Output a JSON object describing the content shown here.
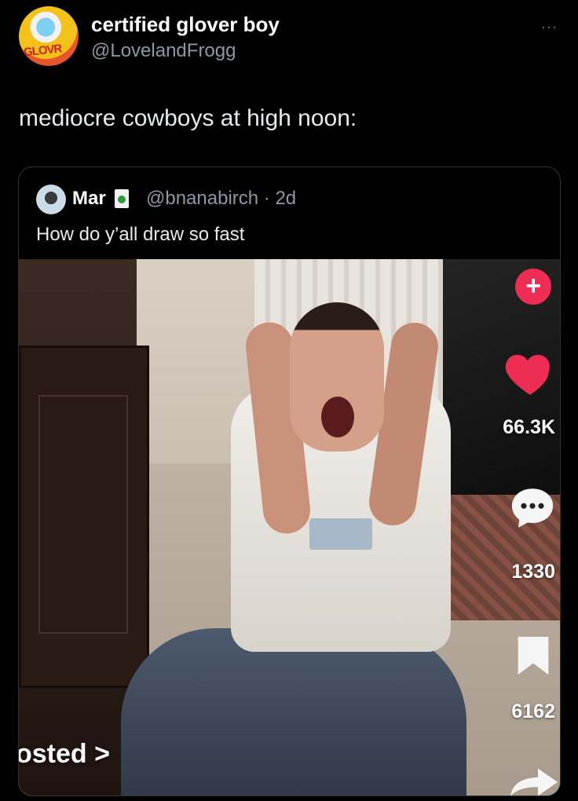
{
  "author": {
    "display_name": "certified glover boy",
    "handle": "@LovelandFrogg",
    "avatar_text": "GLOVR"
  },
  "more_label": "···",
  "tweet": {
    "text": "mediocre cowboys at high noon:"
  },
  "quoted": {
    "display_name": "Mar",
    "handle_time": "@bnanabirch · 2d",
    "text": "How do y’all draw so fast"
  },
  "video_overlay": {
    "plus_label": "+",
    "likes": "66.3K",
    "comments": "1330",
    "bookmarks": "6162",
    "reposted_label": "osted >"
  },
  "colors": {
    "background": "#000000",
    "text": "#e7e9ea",
    "secondary": "#8b98a5",
    "like": "#ee2d55"
  }
}
